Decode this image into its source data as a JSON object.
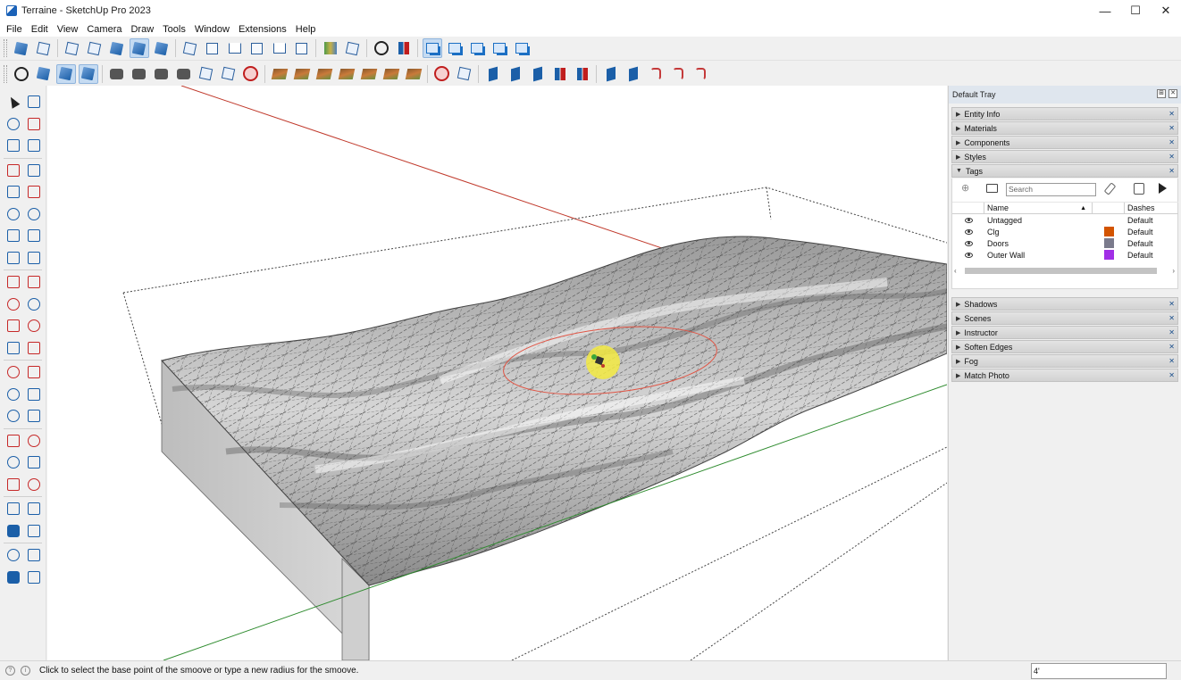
{
  "window": {
    "title": "Terraine - SketchUp Pro 2023",
    "minimize": "—",
    "maximize": "☐",
    "close": "✕"
  },
  "menu": [
    "File",
    "Edit",
    "View",
    "Camera",
    "Draw",
    "Tools",
    "Window",
    "Extensions",
    "Help"
  ],
  "icons": {
    "app": "sketchup-app-icon",
    "camera_standard_views": [
      "iso-view-icon",
      "top-view-icon",
      "front-view-icon",
      "right-view-icon",
      "back-view-icon",
      "left-view-icon"
    ],
    "face_styles": [
      "xray-icon",
      "wireframe-icon",
      "hidden-line-icon",
      "shaded-icon",
      "shaded-textures-icon",
      "monochrome-icon"
    ],
    "sandbox": [
      "from-contours-icon",
      "from-scratch-icon",
      "smoove-icon",
      "stamp-icon",
      "drape-icon",
      "add-detail-icon",
      "flip-edge-icon"
    ]
  },
  "tray": {
    "title": "Default Tray",
    "panels_top": [
      "Entity Info",
      "Materials",
      "Components",
      "Styles"
    ],
    "tags_panel": "Tags",
    "search_placeholder": "Search",
    "columns": {
      "name": "Name",
      "dashes": "Dashes"
    },
    "tags": [
      {
        "name": "Untagged",
        "color": "",
        "dashes": "Default"
      },
      {
        "name": "Clg",
        "color": "#d35400",
        "dashes": "Default"
      },
      {
        "name": "Doors",
        "color": "#7a7a8c",
        "dashes": "Default"
      },
      {
        "name": "Outer Wall",
        "color": "#a12fe6",
        "dashes": "Default"
      }
    ],
    "panels_bottom": [
      "Shadows",
      "Scenes",
      "Instructor",
      "Soften Edges",
      "Fog",
      "Match Photo"
    ]
  },
  "status": {
    "message": "Click to select the base point of the smoove or type a new radius for the smoove.",
    "measurement_value": "4'"
  },
  "colors": {
    "accent": "#1b5fa8",
    "red_axis": "#c0392b",
    "green_axis": "#2e8b2e",
    "smoove_highlight": "#f3ea42"
  }
}
